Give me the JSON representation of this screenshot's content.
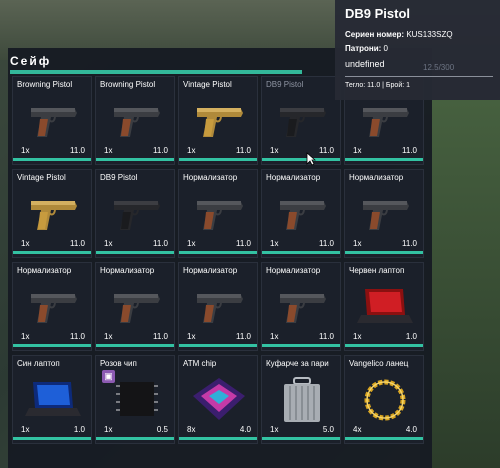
{
  "panel": {
    "title": "Сейф"
  },
  "tooltip": {
    "title": "DB9 Pistol",
    "serial_label": "Сериен номер:",
    "serial_value": "KUS133SZQ",
    "ammo_label": "Патрони:",
    "ammo_value": "0",
    "extra": "undefined",
    "capacity_partial": "12.5/300",
    "footer": "Тегло: 11.0 | Брой: 1"
  },
  "items": [
    {
      "name": "Browning Pistol",
      "count": "1x",
      "weight": "11.0",
      "icon": "pistol-brown"
    },
    {
      "name": "Browning Pistol",
      "count": "1x",
      "weight": "11.0",
      "icon": "pistol-brown"
    },
    {
      "name": "Vintage Pistol",
      "count": "1x",
      "weight": "11.0",
      "icon": "pistol-gold"
    },
    {
      "name": "DB9 Pistol",
      "count": "1x",
      "weight": "11.0",
      "icon": "pistol-black"
    },
    {
      "name": "",
      "count": "1x",
      "weight": "11.0",
      "icon": "pistol-brown"
    },
    {
      "name": "Vintage Pistol",
      "count": "1x",
      "weight": "11.0",
      "icon": "pistol-gold"
    },
    {
      "name": "DB9 Pistol",
      "count": "1x",
      "weight": "11.0",
      "icon": "pistol-black"
    },
    {
      "name": "Нормализатор",
      "count": "1x",
      "weight": "11.0",
      "icon": "pistol-brown"
    },
    {
      "name": "Нормализатор",
      "count": "1x",
      "weight": "11.0",
      "icon": "pistol-brown"
    },
    {
      "name": "Нормализатор",
      "count": "1x",
      "weight": "11.0",
      "icon": "pistol-brown"
    },
    {
      "name": "Нормализатор",
      "count": "1x",
      "weight": "11.0",
      "icon": "pistol-brown"
    },
    {
      "name": "Нормализатор",
      "count": "1x",
      "weight": "11.0",
      "icon": "pistol-brown"
    },
    {
      "name": "Нормализатор",
      "count": "1x",
      "weight": "11.0",
      "icon": "pistol-brown"
    },
    {
      "name": "Нормализатор",
      "count": "1x",
      "weight": "11.0",
      "icon": "pistol-brown"
    },
    {
      "name": "Червен лаптоп",
      "count": "1x",
      "weight": "1.0",
      "icon": "laptop-red"
    },
    {
      "name": "Син лаптоп",
      "count": "1x",
      "weight": "1.0",
      "icon": "laptop-blue"
    },
    {
      "name": "Розов чип",
      "count": "1x",
      "weight": "0.5",
      "icon": "chip"
    },
    {
      "name": "ATM chip",
      "count": "8x",
      "weight": "4.0",
      "icon": "atm-chip"
    },
    {
      "name": "Куфарче за пари",
      "count": "1x",
      "weight": "5.0",
      "icon": "briefcase"
    },
    {
      "name": "Vangelico ланец",
      "count": "4x",
      "weight": "4.0",
      "icon": "gold-chain"
    }
  ],
  "colors": {
    "accent": "#33c2a2",
    "panel": "#161a22"
  }
}
